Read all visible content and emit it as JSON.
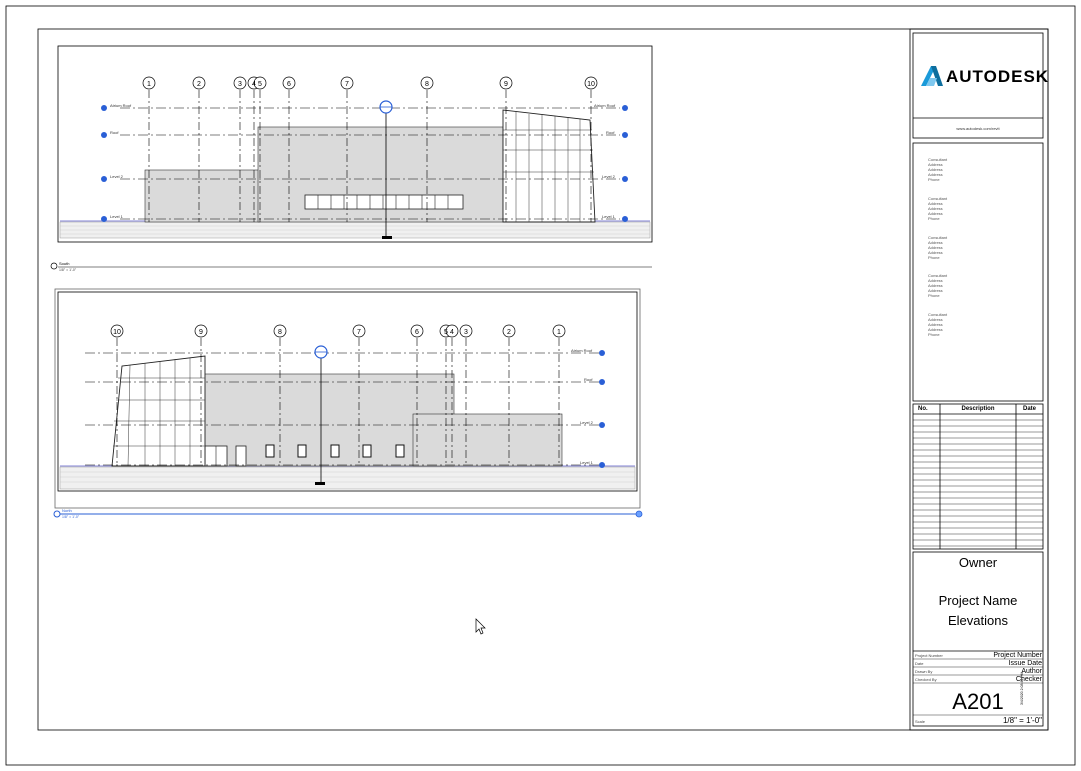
{
  "title_block": {
    "logo_text": "AUTODESK",
    "logo_url": "www.autodesk.com/revit",
    "consultants": [
      "Consultant\nAddress\nAddress\nAddress\nPhone",
      "Consultant\nAddress\nAddress\nAddress\nPhone",
      "Consultant\nAddress\nAddress\nAddress\nPhone",
      "Consultant\nAddress\nAddress\nAddress\nPhone",
      "Consultant\nAddress\nAddress\nAddress\nPhone"
    ],
    "revision_headers": {
      "no": "No.",
      "description": "Description",
      "date": "Date"
    },
    "owner": "Owner",
    "project_name": "Project Name",
    "sheet_name": "Elevations",
    "fields": [
      {
        "label": "Project Number",
        "value": "Project Number"
      },
      {
        "label": "Date",
        "value": "Issue Date"
      },
      {
        "label": "Drawn By",
        "value": "Author"
      },
      {
        "label": "Checked By",
        "value": "Checker"
      }
    ],
    "sheet_number": "A201",
    "scale_label": "Scale",
    "scale_value": "1/8\" = 1'-0\"",
    "timestamp": "3/4/2020 2:08:40 PM"
  },
  "views": {
    "south": {
      "name": "South",
      "scale": "1/8\" = 1'-0\"",
      "grids": [
        "1",
        "2",
        "3",
        "4",
        "5",
        "6",
        "7",
        "8",
        "9",
        "10"
      ],
      "levels": [
        "Atrium Roof",
        "Roof",
        "Level 2",
        "Level 1"
      ]
    },
    "north": {
      "name": "North",
      "scale": "1/8\" = 1'-0\"",
      "grids": [
        "10",
        "9",
        "8",
        "7",
        "6",
        "5",
        "4",
        "3",
        "2",
        "1"
      ],
      "levels": [
        "Atrium Roof",
        "Roof",
        "Level 2",
        "Level 1"
      ]
    }
  },
  "colors": {
    "selection": "#2a5fd6",
    "building_fill": "#dadada",
    "logo_teal": "#1a9ad9"
  }
}
